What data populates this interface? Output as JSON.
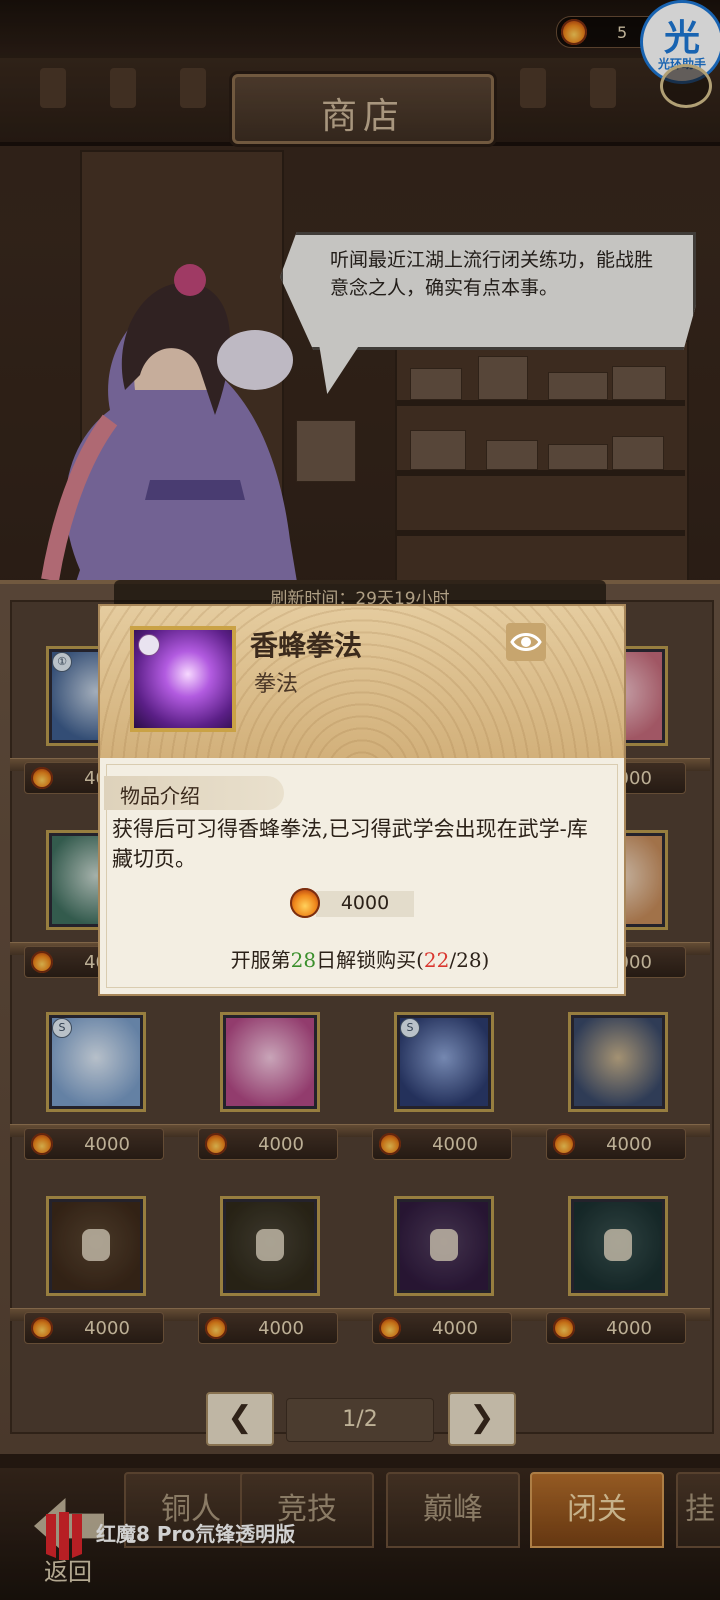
{
  "header": {
    "currency_value": "5",
    "assistant_label": "光环助手",
    "assistant_glyph": "光",
    "shop_title": "商店"
  },
  "npc": {
    "speech": "听闻最近江湖上流行闭关练功，能战胜意念之人，确实有点本事。"
  },
  "shop": {
    "refresh_text": "刷新时间：29天19小时",
    "rows": [
      {
        "items": [
          {
            "price": "4000",
            "tag": "①",
            "locked": false,
            "art": [
              "#3f5f8f",
              "#c7d4e4"
            ]
          },
          {
            "price": "",
            "tag": "",
            "locked": false,
            "art": [
              "#444",
              "#666"
            ]
          },
          {
            "price": "",
            "tag": "",
            "locked": false,
            "art": [
              "#444",
              "#666"
            ]
          },
          {
            "price": "4000",
            "tag": "",
            "locked": false,
            "art": [
              "#c46a7a",
              "#f2c7cf"
            ]
          }
        ]
      },
      {
        "items": [
          {
            "price": "4000",
            "tag": "",
            "locked": false,
            "art": [
              "#3f6f5f",
              "#c9d8d0"
            ]
          },
          {
            "price": "",
            "tag": "",
            "locked": false,
            "art": [
              "#444",
              "#666"
            ]
          },
          {
            "price": "",
            "tag": "",
            "locked": false,
            "art": [
              "#444",
              "#666"
            ]
          },
          {
            "price": "4000",
            "tag": "",
            "locked": false,
            "art": [
              "#c58b5a",
              "#f1dcc6"
            ]
          }
        ]
      },
      {
        "items": [
          {
            "price": "4000",
            "tag": "S",
            "locked": false,
            "art": [
              "#7b9ec9",
              "#dfeaf6"
            ]
          },
          {
            "price": "4000",
            "tag": "",
            "locked": false,
            "art": [
              "#b34a86",
              "#f5c9e1"
            ]
          },
          {
            "price": "4000",
            "tag": "S",
            "locked": false,
            "art": [
              "#2c3c70",
              "#8fa6d8"
            ]
          },
          {
            "price": "4000",
            "tag": "",
            "locked": false,
            "art": [
              "#3a4a6a",
              "#c8b28c"
            ]
          }
        ]
      },
      {
        "items": [
          {
            "price": "4000",
            "tag": "",
            "locked": true,
            "art": [
              "#8a5d3a",
              "#c69a6e"
            ]
          },
          {
            "price": "4000",
            "tag": "",
            "locked": true,
            "art": [
              "#6a5d3a",
              "#a3987a"
            ]
          },
          {
            "price": "4000",
            "tag": "",
            "locked": true,
            "art": [
              "#6a3a8a",
              "#b58ad0"
            ]
          },
          {
            "price": "4000",
            "tag": "",
            "locked": true,
            "art": [
              "#3a6a6a",
              "#7fb3b0"
            ]
          }
        ]
      }
    ],
    "page_indicator": "1/2",
    "prev_label": "❮",
    "next_label": "❯"
  },
  "tabs": {
    "items": [
      {
        "label": "铜人",
        "active": false
      },
      {
        "label": "竞技",
        "active": false
      },
      {
        "label": "巅峰",
        "active": false
      },
      {
        "label": "闭关",
        "active": true
      },
      {
        "label": "挂",
        "active": false
      }
    ],
    "back_label": "返回"
  },
  "device": {
    "model_text": "红魔8 Pro氘锋透明版"
  },
  "popup": {
    "name": "香蜂拳法",
    "type": "拳法",
    "intro_label": "物品介绍",
    "intro_text": "获得后可习得香蜂拳法,已习得武学会出现在武学-库藏切页。",
    "cost": "4000",
    "unlock_prefix": "开服第",
    "unlock_day": "28",
    "unlock_mid": "日解锁购买(",
    "unlock_current": "22",
    "unlock_suffix": "/28)"
  },
  "colors": {
    "accent_tab": "#b56e2b",
    "unlock_green": "#3a8f2c",
    "unlock_red": "#d9362f"
  }
}
